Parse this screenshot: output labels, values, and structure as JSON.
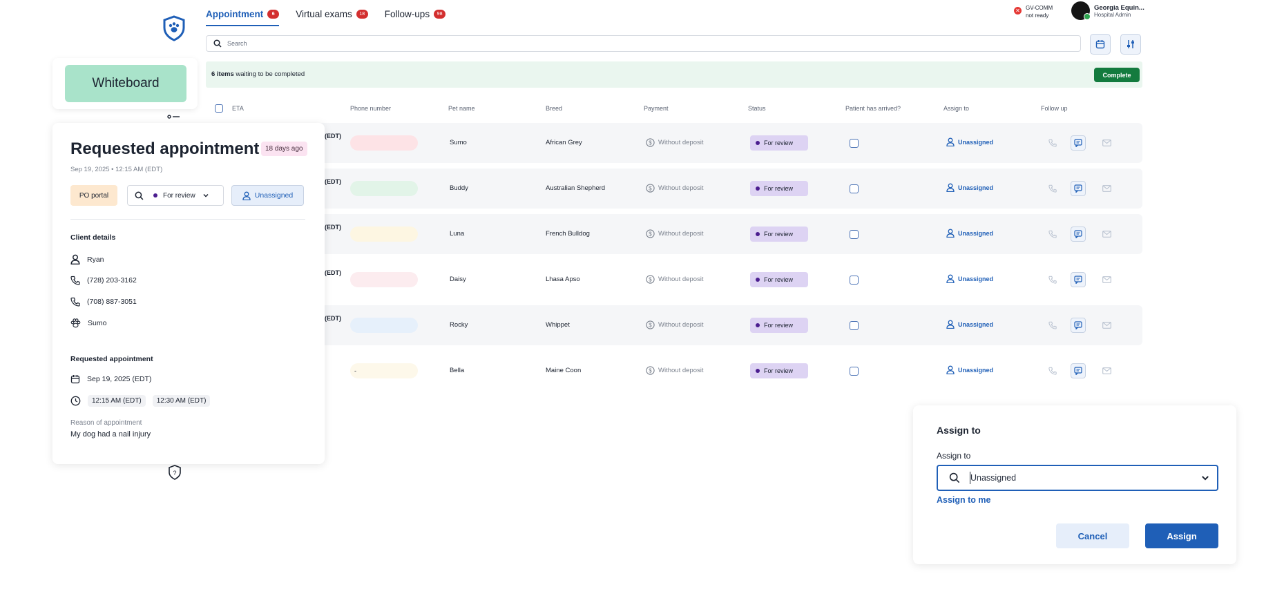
{
  "tabs": [
    {
      "label": "Appointment",
      "count": "6"
    },
    {
      "label": "Virtual exams",
      "count": "18"
    },
    {
      "label": "Follow-ups",
      "count": "98"
    }
  ],
  "gvcomm": {
    "line1": "GV-COMM",
    "line2": "not ready"
  },
  "user": {
    "name": "Georgia Equin...",
    "role": "Hospital Admin"
  },
  "search": {
    "placeholder": "Search"
  },
  "banner": {
    "count_text": "6 items",
    "rest_text": "waiting to be completed",
    "complete_label": "Complete"
  },
  "whiteboard": {
    "label": "Whiteboard"
  },
  "columns": [
    "ETA",
    "Phone number",
    "Pet name",
    "Breed",
    "Payment",
    "Status",
    "Patient has arrived?",
    "Assign to",
    "Follow up"
  ],
  "rows": [
    {
      "eta": "(EDT)",
      "pet": "Sumo",
      "breed": "African Grey",
      "payment": "Without deposit",
      "status": "For review",
      "assign": "Unassigned",
      "phone_color": "#fde3e6",
      "shade": true
    },
    {
      "eta": "(EDT)",
      "pet": "Buddy",
      "breed": "Australian Shepherd",
      "payment": "Without deposit",
      "status": "For review",
      "assign": "Unassigned",
      "phone_color": "#e2f4e8",
      "shade": true
    },
    {
      "eta": "(EDT)",
      "pet": "Luna",
      "breed": "French Bulldog",
      "payment": "Without deposit",
      "status": "For review",
      "assign": "Unassigned",
      "phone_color": "#fdf6e2",
      "shade": true
    },
    {
      "eta": "(EDT)",
      "pet": "Daisy",
      "breed": "Lhasa Apso",
      "payment": "Without deposit",
      "status": "For review",
      "assign": "Unassigned",
      "phone_color": "#fcecef",
      "shade": false
    },
    {
      "eta": "(EDT)",
      "pet": "Rocky",
      "breed": "Whippet",
      "payment": "Without deposit",
      "status": "For review",
      "assign": "Unassigned",
      "phone_color": "#e6f0fb",
      "shade": true
    },
    {
      "eta": "",
      "pet": "Bella",
      "breed": "Maine Coon",
      "payment": "Without deposit",
      "status": "For review",
      "assign": "Unassigned",
      "phone_color": "#fdf8ea",
      "phone_text": "-",
      "shade": false
    }
  ],
  "panel": {
    "title": "Requested appointment",
    "ago": "18 days ago",
    "date": "Sep 19, 2025 • 12:15 AM (EDT)",
    "source": "PO portal",
    "status": "For review",
    "assign": "Unassigned",
    "client_heading": "Client details",
    "client_name": "Ryan",
    "phone1": "(728) 203-3162",
    "phone2": "(708) 887-3051",
    "pet": "Sumo",
    "req_heading": "Requested appointment",
    "req_date": "Sep 19, 2025 (EDT)",
    "time_start": "12:15 AM (EDT)",
    "time_end": "12:30 AM (EDT)",
    "reason_label": "Reason of appointment",
    "reason": "My dog had a nail injury"
  },
  "dialog": {
    "title": "Assign to",
    "label": "Assign to",
    "value": "Unassigned",
    "assign_me": "Assign to me",
    "cancel": "Cancel",
    "assign": "Assign"
  },
  "colors": {
    "primary": "#1f5fb7",
    "success": "#137b3e",
    "status_bg": "#ddd3f3",
    "whiteboard": "#a9e3ca",
    "badge": "#d32f2f"
  }
}
